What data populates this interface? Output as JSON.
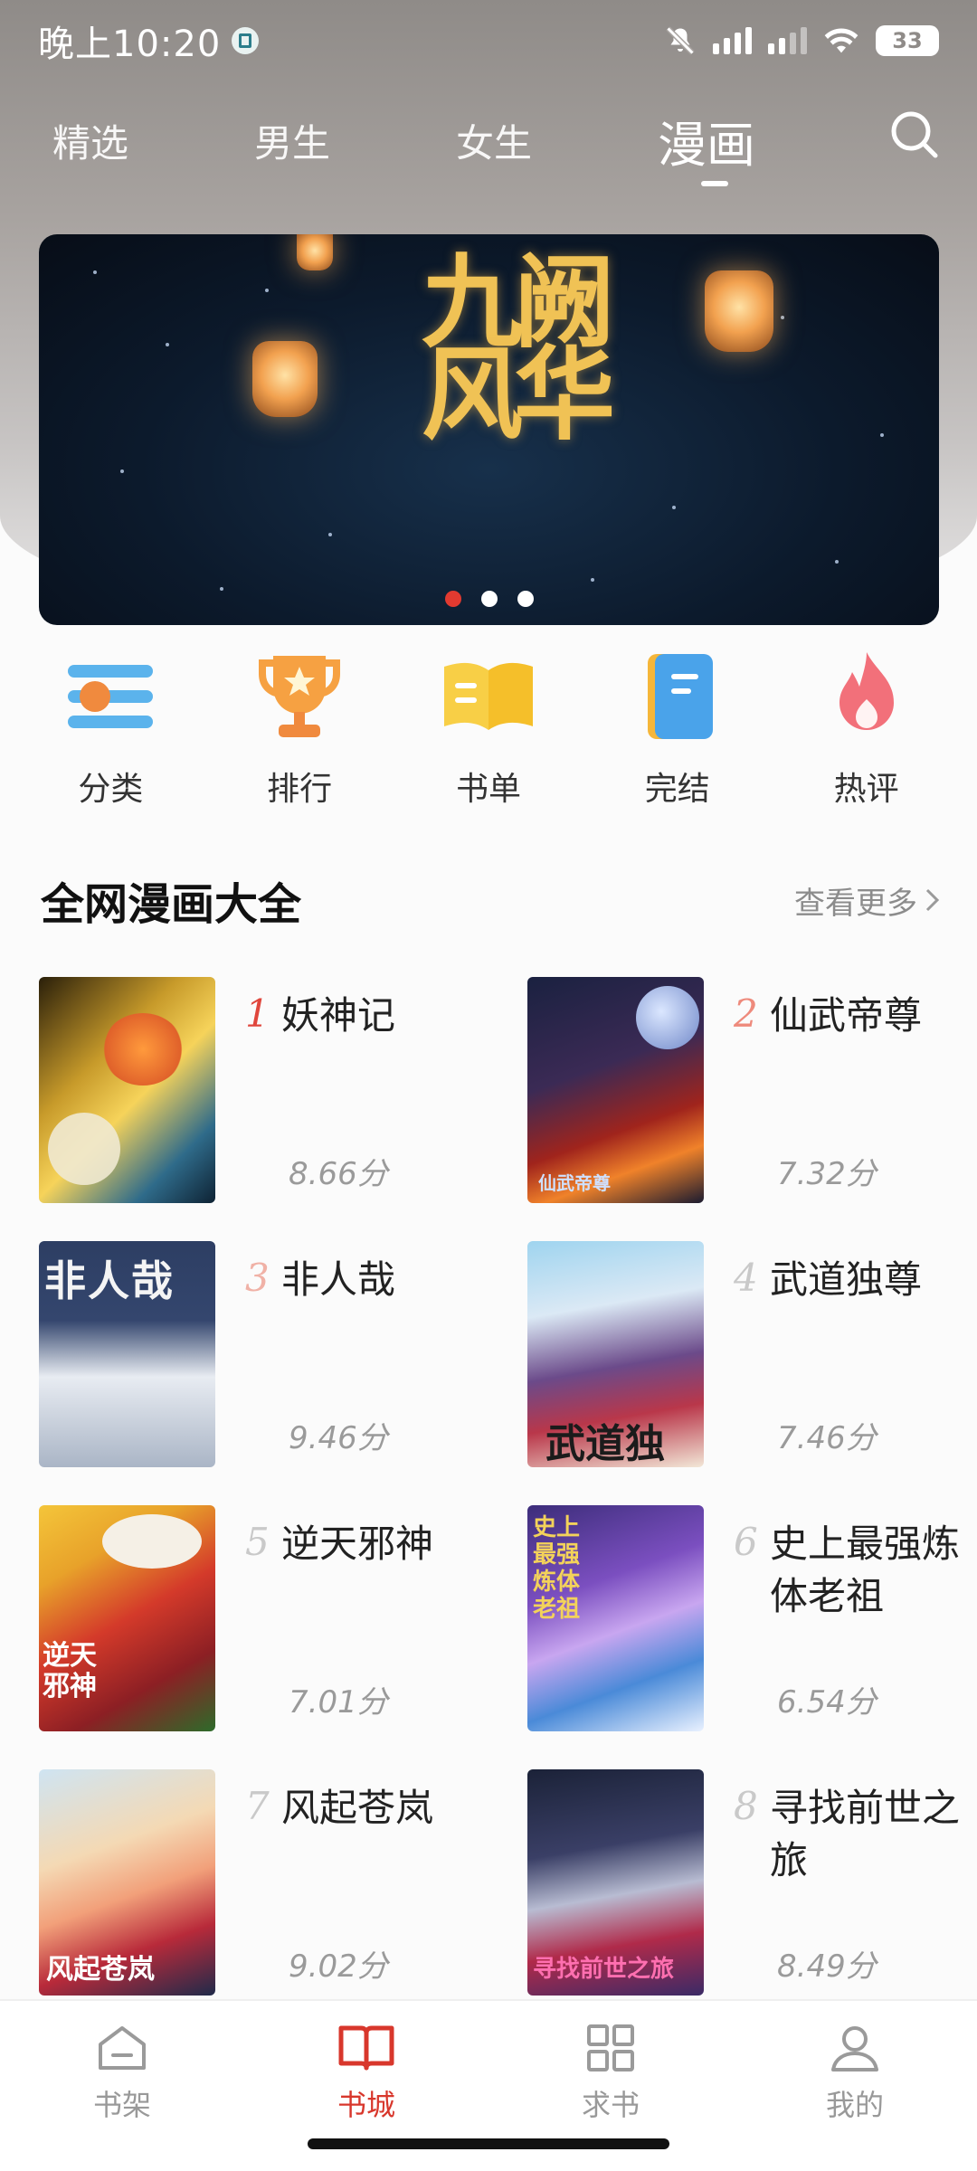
{
  "status_bar": {
    "time": "晚上10:20",
    "battery": "33"
  },
  "top_tabs": [
    {
      "label": "精选",
      "active": false
    },
    {
      "label": "男生",
      "active": false
    },
    {
      "label": "女生",
      "active": false
    },
    {
      "label": "漫画",
      "active": true
    }
  ],
  "search": {
    "icon": "search-icon"
  },
  "banner": {
    "title_text": "九阙风华",
    "page_count": 3,
    "active_index": 0,
    "accent_color": "#e23a30"
  },
  "categories": [
    {
      "label": "分类",
      "icon": "category-icon"
    },
    {
      "label": "排行",
      "icon": "trophy-icon"
    },
    {
      "label": "书单",
      "icon": "book-list-icon"
    },
    {
      "label": "完结",
      "icon": "finished-book-icon"
    },
    {
      "label": "热评",
      "icon": "flame-icon"
    }
  ],
  "section": {
    "title": "全网漫画大全",
    "more_label": "查看更多"
  },
  "books": [
    {
      "rank": "1",
      "title": "妖神记",
      "score": "8.66分",
      "cover_text": ""
    },
    {
      "rank": "2",
      "title": "仙武帝尊",
      "score": "7.32分",
      "cover_text": "仙武帝尊"
    },
    {
      "rank": "3",
      "title": "非人哉",
      "score": "9.46分",
      "cover_text": "非人哉"
    },
    {
      "rank": "4",
      "title": "武道独尊",
      "score": "7.46分",
      "cover_text": "武道独尊"
    },
    {
      "rank": "5",
      "title": "逆天邪神",
      "score": "7.01分",
      "cover_text": "逆天邪神"
    },
    {
      "rank": "6",
      "title": "史上最强炼体老祖",
      "score": "6.54分",
      "cover_text": "史上最强炼体老祖"
    },
    {
      "rank": "7",
      "title": "风起苍岚",
      "score": "9.02分",
      "cover_text": "风起苍岚"
    },
    {
      "rank": "8",
      "title": "寻找前世之旅",
      "score": "8.49分",
      "cover_text": "寻找前世之旅"
    }
  ],
  "rank_colors": [
    "#e0463c",
    "#ee8a7c",
    "#f0b1a6",
    "#c9c9c9"
  ],
  "bottom_nav": [
    {
      "label": "书架",
      "icon": "bookshelf-icon",
      "active": false
    },
    {
      "label": "书城",
      "icon": "book-store-icon",
      "active": true
    },
    {
      "label": "求书",
      "icon": "request-book-icon",
      "active": false
    },
    {
      "label": "我的",
      "icon": "profile-icon",
      "active": false
    }
  ]
}
